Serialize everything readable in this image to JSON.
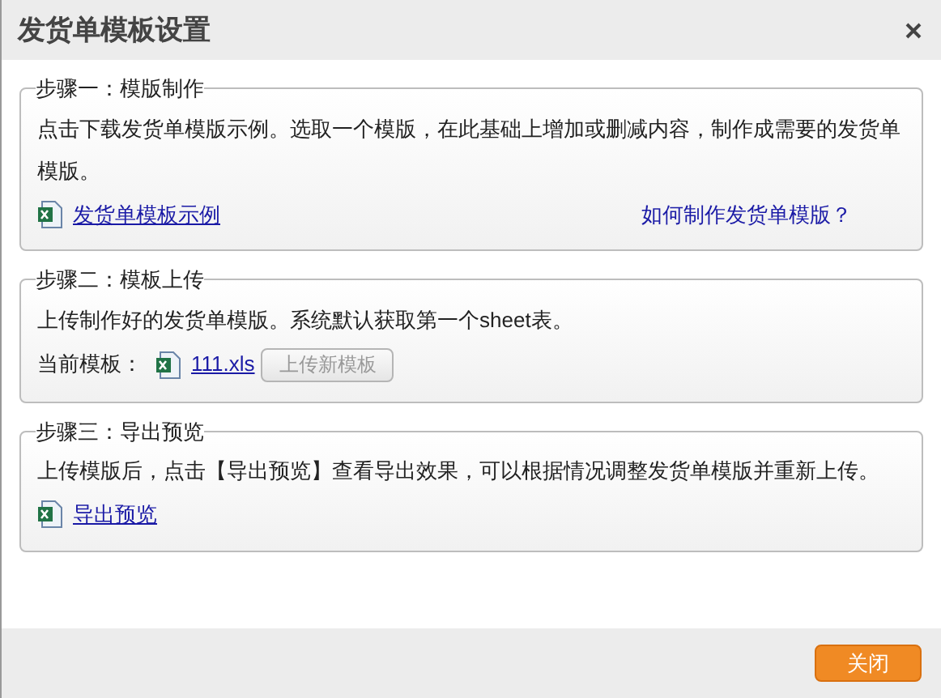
{
  "window": {
    "title": "发货单模板设置"
  },
  "steps": [
    {
      "title": "步骤一：模版制作",
      "description": "点击下载发货单模版示例。选取一个模版，在此基础上增加或删减内容，制作成需要的发货单模版。",
      "items": [
        {
          "kind": "file_link",
          "text": "发货单模板示例"
        },
        {
          "kind": "help_link",
          "text": "如何制作发货单模版？"
        }
      ]
    },
    {
      "title": "步骤二：模板上传",
      "description": "上传制作好的发货单模版。系统默认获取第一个sheet表。",
      "items": [
        {
          "kind": "label",
          "text": "当前模板："
        },
        {
          "kind": "file_link",
          "text": "111.xls"
        },
        {
          "kind": "button",
          "text": "上传新模板"
        }
      ]
    },
    {
      "title": "步骤三：导出预览",
      "description": "上传模版后，点击【导出预览】查看导出效果，可以根据情况调整发货单模版并重新上传。",
      "items": [
        {
          "kind": "file_link",
          "text": "导出预览"
        }
      ]
    }
  ],
  "footer": {
    "button": "关闭"
  }
}
